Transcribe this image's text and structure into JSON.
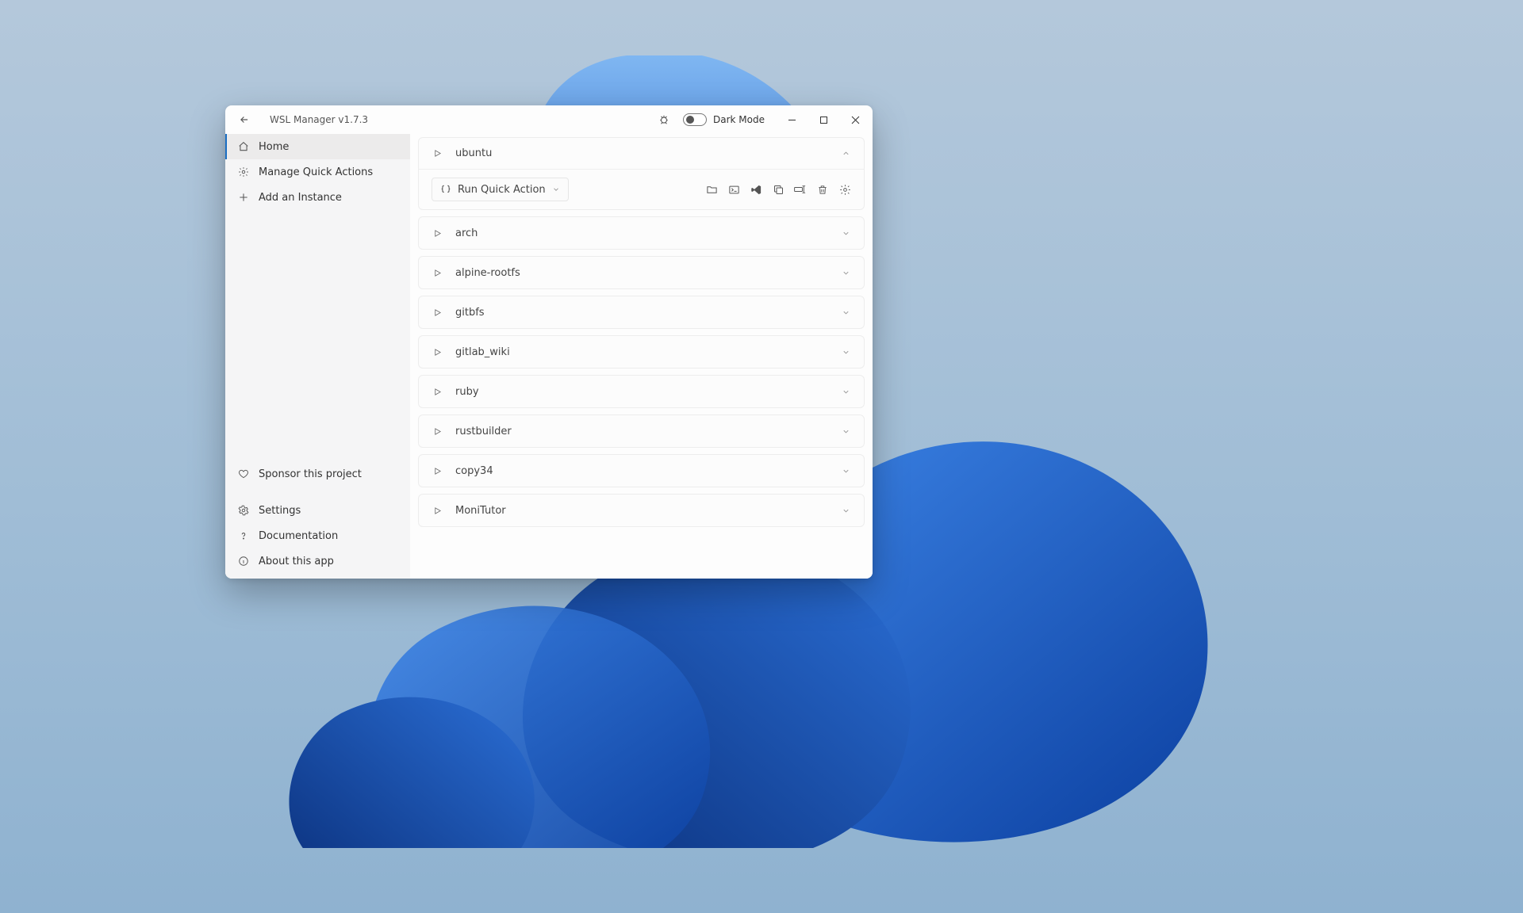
{
  "app": {
    "title": "WSL Manager v1.7.3",
    "dark_mode_label": "Dark Mode"
  },
  "sidebar": {
    "top": [
      {
        "label": "Home"
      },
      {
        "label": "Manage Quick Actions"
      },
      {
        "label": "Add an Instance"
      }
    ],
    "bottom": [
      {
        "label": "Sponsor this project"
      },
      {
        "label": "Settings"
      },
      {
        "label": "Documentation"
      },
      {
        "label": "About this app"
      }
    ]
  },
  "run_quick_action": {
    "label": "Run Quick Action"
  },
  "instances": [
    {
      "name": "ubuntu"
    },
    {
      "name": "arch"
    },
    {
      "name": "alpine-rootfs"
    },
    {
      "name": "gitbfs"
    },
    {
      "name": "gitlab_wiki"
    },
    {
      "name": "ruby"
    },
    {
      "name": "rustbuilder"
    },
    {
      "name": "copy34"
    },
    {
      "name": "MoniTutor"
    }
  ]
}
